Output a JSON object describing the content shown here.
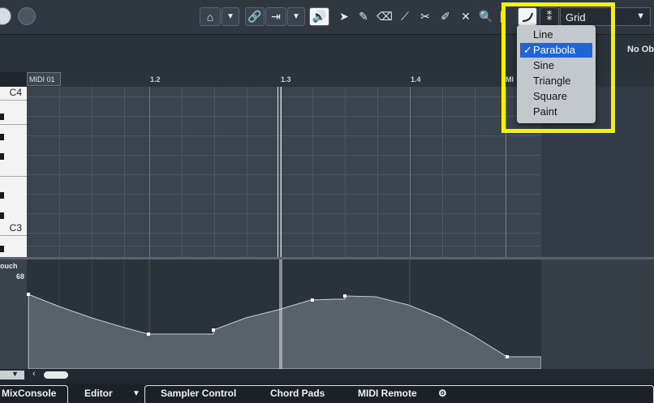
{
  "toolbar": {
    "grid_select_value": "Grid",
    "curve_icon": "parabola-curve-icon"
  },
  "info_line": {
    "no_object_label": "No Ob"
  },
  "ruler": {
    "part_label": "MIDI 01",
    "ticks": [
      "1.2",
      "1.3",
      "1.4"
    ],
    "end_label": "MI"
  },
  "keyboard": {
    "labels": [
      "C4",
      "C3"
    ]
  },
  "controller": {
    "name": "ouch",
    "value": "68"
  },
  "line_type_menu": {
    "items": [
      "Line",
      "Parabola",
      "Sine",
      "Triangle",
      "Square",
      "Paint"
    ],
    "selected": "Parabola"
  },
  "bottom_tabs": {
    "mixconsole": "MixConsole",
    "editor": "Editor",
    "sampler": "Sampler Control",
    "chord_pads": "Chord Pads",
    "midi_remote": "MIDI Remote"
  },
  "colors": {
    "highlight": "#f5f00a",
    "menu_selected": "#2064d6"
  }
}
